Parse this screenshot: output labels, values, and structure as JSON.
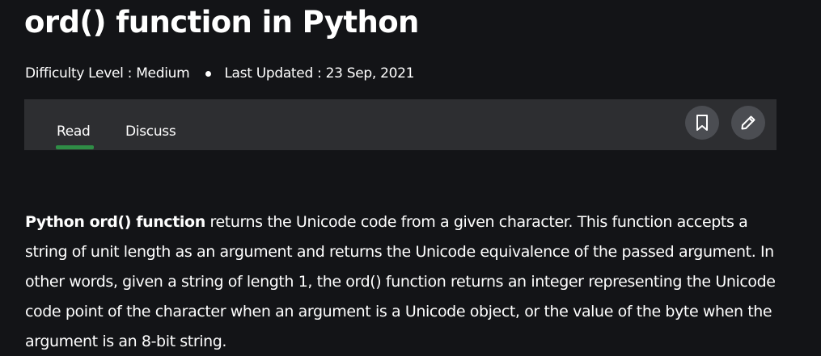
{
  "article": {
    "title": "ord() function in Python",
    "difficulty": "Difficulty Level : Medium",
    "last_updated": "Last Updated : 23 Sep, 2021"
  },
  "tabs": {
    "read": "Read",
    "discuss": "Discuss",
    "active": "Read"
  },
  "actions": {
    "bookmark_icon": "bookmark-icon",
    "edit_icon": "pencil-icon"
  },
  "body": {
    "intro_bold": "Python ord() function",
    "intro_text": " returns the Unicode code from a given character. This function accepts a string of unit length as an argument and returns the Unicode equivalence of the passed argument. In other words, given a string of length 1, the ord() function returns an integer representing the Unicode code point of the character when an argument is a Unicode object, or the value of the byte when the argument is an 8-bit string."
  },
  "colors": {
    "background": "#131417",
    "tabbar": "#2d2e31",
    "accent": "#2f8d46",
    "icon_button": "#4b4d52"
  }
}
